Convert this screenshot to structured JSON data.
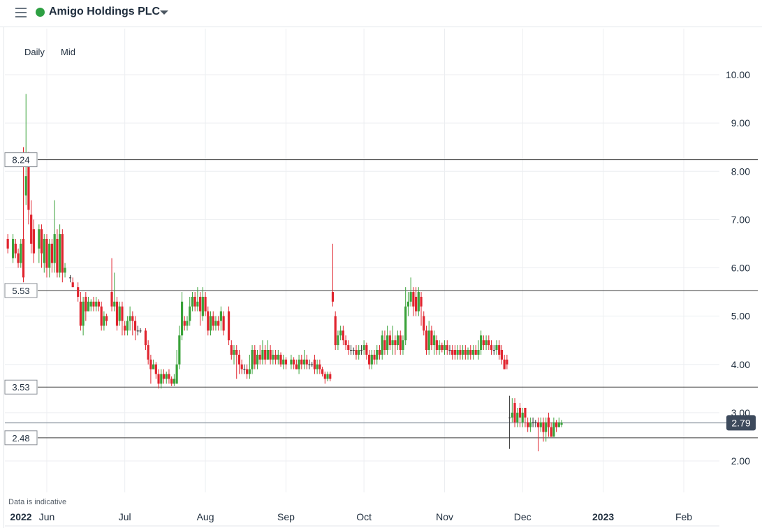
{
  "header": {
    "title": "Amigo Holdings PLC",
    "status_color": "#2ea043"
  },
  "options": {
    "interval": "Daily",
    "price_type": "Mid"
  },
  "note": "Data is indicative",
  "colors": {
    "up": "#3aa23a",
    "down": "#e0242e",
    "flat": "#333333",
    "last_price_tag": "#3d4a5c"
  },
  "chart_data": {
    "type": "candlestick",
    "y_ticks": [
      "2.00",
      "3.00",
      "4.00",
      "5.00",
      "6.00",
      "7.00",
      "8.00",
      "9.00",
      "10.00"
    ],
    "ylim": [
      1.5,
      10.7
    ],
    "x_ticks": [
      {
        "label": "2022",
        "day": -5
      },
      {
        "label": "Jun",
        "day": 0
      },
      {
        "label": "Jul",
        "day": 30
      },
      {
        "label": "Aug",
        "day": 61
      },
      {
        "label": "Sep",
        "day": 92
      },
      {
        "label": "Oct",
        "day": 122
      },
      {
        "label": "Nov",
        "day": 153
      },
      {
        "label": "Dec",
        "day": 183
      },
      {
        "label": "2023",
        "day": 214
      },
      {
        "label": "Feb",
        "day": 245
      }
    ],
    "xlim": [
      -15,
      256
    ],
    "levels": [
      "8.24",
      "5.53",
      "3.53",
      "2.48"
    ],
    "last_price": "2.79",
    "candles": [
      [
        -15,
        6.6,
        6.4,
        6.7,
        6.3
      ],
      [
        -13,
        6.2,
        6.6,
        6.7,
        6.1
      ],
      [
        -12,
        6.5,
        6.3,
        6.6,
        6.2
      ],
      [
        -11,
        6.3,
        6.1,
        6.4,
        6.0
      ],
      [
        -10,
        6.1,
        6.5,
        6.6,
        6.0
      ],
      [
        -9,
        6.6,
        5.8,
        8.5,
        5.7
      ],
      [
        -8,
        7.5,
        7.9,
        9.6,
        7.3
      ],
      [
        -7,
        8.3,
        7.2,
        8.4,
        6.9
      ],
      [
        -6,
        7.1,
        6.5,
        7.4,
        6.3
      ],
      [
        -5,
        6.8,
        6.3,
        7.0,
        6.1
      ],
      [
        -3,
        6.4,
        6.8,
        6.9,
        6.1
      ],
      [
        -2,
        6.8,
        6.3,
        6.9,
        6.0
      ],
      [
        -1,
        6.1,
        6.6,
        6.7,
        5.9
      ],
      [
        0,
        6.6,
        6.0,
        6.7,
        5.8
      ],
      [
        1,
        6.0,
        6.5,
        6.6,
        5.8
      ],
      [
        2,
        6.5,
        6.1,
        6.6,
        5.9
      ],
      [
        3,
        6.1,
        6.7,
        7.4,
        5.9
      ],
      [
        4,
        6.6,
        5.9,
        6.8,
        5.8
      ],
      [
        5,
        5.9,
        6.7,
        6.9,
        5.8
      ],
      [
        6,
        6.7,
        5.9,
        6.8,
        5.7
      ],
      [
        7,
        5.9,
        6.0,
        6.1,
        5.8
      ],
      [
        9,
        5.8,
        5.8,
        5.85,
        5.7
      ],
      [
        10,
        5.7,
        5.6,
        5.8,
        5.6
      ],
      [
        12,
        5.6,
        5.4,
        5.7,
        5.3
      ],
      [
        13,
        5.3,
        4.8,
        5.5,
        4.7
      ],
      [
        14,
        4.8,
        5.3,
        5.4,
        4.6
      ],
      [
        15,
        5.4,
        5.1,
        5.5,
        4.9
      ],
      [
        16,
        5.1,
        5.3,
        5.4,
        5.1
      ],
      [
        17,
        5.2,
        5.3,
        5.35,
        5.1
      ],
      [
        18,
        5.3,
        5.2,
        5.4,
        5.1
      ],
      [
        19,
        5.2,
        5.3,
        5.4,
        5.1
      ],
      [
        20,
        5.3,
        5.2,
        5.35,
        5.1
      ],
      [
        21,
        5.2,
        4.8,
        5.3,
        4.7
      ],
      [
        22,
        4.8,
        5.0,
        5.1,
        4.7
      ],
      [
        23,
        5.0,
        4.9,
        5.05,
        4.8
      ],
      [
        25,
        5.5,
        5.2,
        6.2,
        5.1
      ],
      [
        26,
        5.2,
        5.3,
        5.9,
        5.1
      ],
      [
        27,
        5.3,
        4.8,
        5.4,
        4.7
      ],
      [
        28,
        4.9,
        5.2,
        5.3,
        4.8
      ],
      [
        29,
        5.2,
        4.9,
        5.3,
        4.6
      ],
      [
        30,
        4.8,
        4.7,
        4.9,
        4.6
      ],
      [
        31,
        4.7,
        4.9,
        5.0,
        4.6
      ],
      [
        32,
        4.9,
        5.0,
        5.2,
        4.7
      ],
      [
        33,
        5.0,
        4.9,
        5.1,
        4.6
      ],
      [
        34,
        4.9,
        4.7,
        5.0,
        4.5
      ],
      [
        35,
        4.7,
        4.7,
        4.8,
        4.6
      ],
      [
        36,
        4.7,
        4.7,
        4.75,
        4.65
      ],
      [
        38,
        4.7,
        4.4,
        4.75,
        4.3
      ],
      [
        39,
        4.4,
        4.1,
        4.5,
        4.0
      ],
      [
        40,
        4.1,
        3.9,
        4.2,
        3.6
      ],
      [
        41,
        3.9,
        4.0,
        4.1,
        3.9
      ],
      [
        42,
        4.0,
        3.8,
        4.05,
        3.7
      ],
      [
        43,
        3.8,
        3.6,
        3.9,
        3.5
      ],
      [
        44,
        3.6,
        3.8,
        3.9,
        3.5
      ],
      [
        45,
        3.8,
        3.7,
        3.9,
        3.6
      ],
      [
        46,
        3.7,
        3.8,
        3.85,
        3.6
      ],
      [
        47,
        3.8,
        3.7,
        3.9,
        3.6
      ],
      [
        48,
        3.7,
        3.6,
        3.75,
        3.55
      ],
      [
        49,
        3.6,
        3.7,
        3.8,
        3.55
      ],
      [
        50,
        3.6,
        4.0,
        4.3,
        3.6
      ],
      [
        51,
        4.0,
        4.6,
        4.8,
        3.9
      ],
      [
        52,
        4.6,
        5.3,
        5.5,
        4.5
      ],
      [
        53,
        4.9,
        4.8,
        5.0,
        4.7
      ],
      [
        54,
        4.8,
        4.9,
        5.0,
        4.7
      ],
      [
        55,
        4.9,
        5.2,
        5.4,
        4.8
      ],
      [
        56,
        5.2,
        5.4,
        5.5,
        5.1
      ],
      [
        57,
        5.4,
        5.2,
        5.5,
        5.1
      ],
      [
        58,
        5.2,
        5.3,
        5.6,
        5.1
      ],
      [
        59,
        5.4,
        5.1,
        5.5,
        4.8
      ],
      [
        60,
        5.0,
        5.4,
        5.6,
        4.9
      ],
      [
        61,
        5.4,
        5.1,
        5.5,
        5.0
      ],
      [
        62,
        5.1,
        4.7,
        5.2,
        4.6
      ],
      [
        63,
        4.7,
        5.0,
        5.1,
        4.6
      ],
      [
        64,
        5.0,
        4.8,
        5.1,
        4.7
      ],
      [
        65,
        4.8,
        4.9,
        5.0,
        4.7
      ],
      [
        66,
        4.9,
        4.8,
        5.0,
        4.7
      ],
      [
        67,
        4.9,
        5.1,
        5.2,
        4.7
      ],
      [
        68,
        5.0,
        4.7,
        5.1,
        4.6
      ],
      [
        70,
        5.1,
        4.5,
        5.2,
        4.4
      ],
      [
        71,
        4.4,
        4.2,
        4.5,
        4.1
      ],
      [
        72,
        4.2,
        4.3,
        4.4,
        4.0
      ],
      [
        73,
        4.3,
        4.2,
        4.4,
        3.7
      ],
      [
        74,
        4.2,
        4.0,
        4.3,
        3.8
      ],
      [
        75,
        4.0,
        3.9,
        4.1,
        3.8
      ],
      [
        76,
        3.9,
        3.9,
        4.0,
        3.8
      ],
      [
        77,
        3.9,
        3.8,
        4.0,
        3.7
      ],
      [
        78,
        3.8,
        3.9,
        4.2,
        3.7
      ],
      [
        79,
        3.9,
        4.3,
        4.4,
        3.8
      ],
      [
        80,
        4.3,
        4.0,
        4.4,
        3.9
      ],
      [
        81,
        4.0,
        4.2,
        4.3,
        3.9
      ],
      [
        82,
        4.2,
        4.1,
        4.4,
        4.0
      ],
      [
        83,
        4.1,
        4.3,
        4.5,
        4.0
      ],
      [
        84,
        4.3,
        4.1,
        4.4,
        4.0
      ],
      [
        85,
        4.1,
        4.3,
        4.5,
        4.1
      ],
      [
        86,
        4.3,
        4.1,
        4.4,
        4.0
      ],
      [
        87,
        4.1,
        4.2,
        4.3,
        4.0
      ],
      [
        88,
        4.2,
        4.1,
        4.3,
        4.0
      ],
      [
        89,
        4.1,
        4.2,
        4.3,
        4.0
      ],
      [
        90,
        4.2,
        4.0,
        4.25,
        3.95
      ],
      [
        91,
        4.0,
        4.1,
        4.2,
        3.9
      ],
      [
        92,
        4.1,
        4.0,
        4.15,
        3.9
      ],
      [
        94,
        4.0,
        4.1,
        4.2,
        3.9
      ],
      [
        95,
        4.1,
        4.0,
        4.15,
        3.9
      ],
      [
        96,
        4.0,
        3.9,
        4.1,
        3.9
      ],
      [
        97,
        3.9,
        4.1,
        4.2,
        3.8
      ],
      [
        98,
        4.1,
        4.0,
        4.2,
        3.9
      ],
      [
        99,
        4.0,
        4.1,
        4.3,
        3.9
      ],
      [
        100,
        4.1,
        4.0,
        4.2,
        3.9
      ],
      [
        101,
        4.0,
        4.0,
        4.1,
        3.9
      ],
      [
        102,
        4.0,
        4.0,
        4.05,
        3.95
      ],
      [
        103,
        4.1,
        3.9,
        4.2,
        3.8
      ],
      [
        104,
        3.9,
        4.0,
        4.1,
        3.8
      ],
      [
        105,
        4.0,
        3.9,
        4.1,
        3.8
      ],
      [
        106,
        3.9,
        3.8,
        3.95,
        3.75
      ],
      [
        107,
        3.8,
        3.7,
        3.85,
        3.6
      ],
      [
        108,
        3.7,
        3.8,
        3.85,
        3.65
      ],
      [
        109,
        3.8,
        3.7,
        3.85,
        3.65
      ],
      [
        110,
        5.5,
        5.3,
        6.5,
        5.2
      ],
      [
        111,
        5.0,
        4.4,
        5.1,
        4.3
      ],
      [
        112,
        4.4,
        4.6,
        4.7,
        4.3
      ],
      [
        113,
        4.6,
        4.7,
        4.8,
        4.5
      ],
      [
        114,
        4.7,
        4.5,
        4.8,
        4.4
      ],
      [
        115,
        4.5,
        4.4,
        4.6,
        4.3
      ],
      [
        116,
        4.4,
        4.3,
        4.5,
        4.2
      ],
      [
        117,
        4.3,
        4.3,
        4.4,
        4.2
      ],
      [
        118,
        4.3,
        4.3,
        4.35,
        4.2
      ],
      [
        119,
        4.3,
        4.2,
        4.4,
        4.1
      ],
      [
        120,
        4.2,
        4.3,
        4.4,
        4.1
      ],
      [
        121,
        4.3,
        4.3,
        4.4,
        4.2
      ],
      [
        122,
        4.3,
        4.4,
        4.5,
        4.2
      ],
      [
        123,
        4.4,
        4.2,
        4.45,
        4.1
      ],
      [
        124,
        4.2,
        4.0,
        4.3,
        3.9
      ],
      [
        125,
        4.0,
        4.2,
        4.3,
        3.9
      ],
      [
        126,
        4.2,
        4.1,
        4.3,
        4.0
      ],
      [
        127,
        4.1,
        4.3,
        4.4,
        4.0
      ],
      [
        128,
        4.3,
        4.2,
        4.4,
        4.1
      ],
      [
        129,
        4.2,
        4.6,
        4.7,
        4.1
      ],
      [
        130,
        4.5,
        4.3,
        4.7,
        4.2
      ],
      [
        131,
        4.3,
        4.6,
        4.8,
        4.2
      ],
      [
        132,
        4.6,
        4.4,
        4.7,
        4.3
      ],
      [
        133,
        4.4,
        4.5,
        4.8,
        4.2
      ],
      [
        134,
        4.5,
        4.4,
        4.6,
        4.2
      ],
      [
        135,
        4.4,
        4.6,
        4.7,
        4.3
      ],
      [
        136,
        4.6,
        4.3,
        4.7,
        4.2
      ],
      [
        137,
        4.3,
        4.5,
        4.6,
        4.2
      ],
      [
        138,
        4.5,
        5.2,
        5.6,
        4.4
      ],
      [
        139,
        5.2,
        5.3,
        5.5,
        5.0
      ],
      [
        140,
        5.3,
        5.5,
        5.8,
        5.2
      ],
      [
        141,
        5.5,
        5.2,
        5.6,
        5.0
      ],
      [
        142,
        5.4,
        5.1,
        5.6,
        5.0
      ],
      [
        143,
        5.1,
        5.5,
        5.6,
        5.0
      ],
      [
        144,
        5.4,
        5.2,
        5.5,
        4.8
      ],
      [
        145,
        5.0,
        4.7,
        5.1,
        4.6
      ],
      [
        146,
        4.7,
        4.3,
        4.8,
        4.2
      ],
      [
        147,
        4.3,
        4.7,
        4.9,
        4.2
      ],
      [
        148,
        4.7,
        4.4,
        4.8,
        4.3
      ],
      [
        149,
        4.4,
        4.6,
        4.7,
        4.2
      ],
      [
        150,
        4.5,
        4.3,
        4.6,
        4.2
      ],
      [
        151,
        4.3,
        4.4,
        4.5,
        4.2
      ],
      [
        152,
        4.4,
        4.3,
        4.45,
        4.25
      ],
      [
        153,
        4.3,
        4.4,
        4.5,
        4.2
      ],
      [
        154,
        4.4,
        4.3,
        4.5,
        4.2
      ],
      [
        155,
        4.3,
        4.3,
        4.4,
        4.2
      ],
      [
        156,
        4.3,
        4.2,
        4.4,
        4.1
      ],
      [
        157,
        4.3,
        4.2,
        4.4,
        4.1
      ],
      [
        158,
        4.2,
        4.3,
        4.4,
        4.1
      ],
      [
        159,
        4.3,
        4.2,
        4.4,
        4.1
      ],
      [
        160,
        4.2,
        4.3,
        4.4,
        4.1
      ],
      [
        161,
        4.3,
        4.2,
        4.4,
        4.1
      ],
      [
        162,
        4.2,
        4.3,
        4.35,
        4.1
      ],
      [
        163,
        4.3,
        4.2,
        4.4,
        4.1
      ],
      [
        164,
        4.2,
        4.3,
        4.4,
        4.1
      ],
      [
        165,
        4.3,
        4.2,
        4.4,
        4.2
      ],
      [
        166,
        4.2,
        4.3,
        4.5,
        4.1
      ],
      [
        167,
        4.3,
        4.6,
        4.7,
        4.2
      ],
      [
        168,
        4.5,
        4.4,
        4.6,
        4.3
      ],
      [
        169,
        4.4,
        4.5,
        4.6,
        4.3
      ],
      [
        170,
        4.5,
        4.4,
        4.6,
        4.3
      ],
      [
        171,
        4.4,
        4.3,
        4.5,
        4.2
      ],
      [
        172,
        4.3,
        4.3,
        4.4,
        4.2
      ],
      [
        173,
        4.3,
        4.4,
        4.5,
        4.2
      ],
      [
        174,
        4.4,
        4.2,
        4.5,
        4.1
      ],
      [
        175,
        4.3,
        4.1,
        4.4,
        4.0
      ],
      [
        176,
        4.1,
        3.9,
        4.2,
        3.9
      ],
      [
        177,
        4.1,
        4.0,
        4.2,
        3.9
      ],
      [
        178,
        2.9,
        2.9,
        3.35,
        2.25
      ],
      [
        179,
        2.9,
        3.0,
        3.3,
        2.8
      ],
      [
        180,
        3.2,
        2.8,
        3.3,
        2.7
      ],
      [
        181,
        2.8,
        3.0,
        3.1,
        2.7
      ],
      [
        182,
        3.1,
        2.9,
        3.2,
        2.7
      ],
      [
        183,
        2.8,
        3.0,
        3.1,
        2.7
      ],
      [
        184,
        3.1,
        2.9,
        3.1,
        2.7
      ],
      [
        185,
        2.8,
        2.7,
        2.9,
        2.6
      ],
      [
        186,
        2.7,
        2.8,
        2.9,
        2.6
      ],
      [
        187,
        2.8,
        2.8,
        2.9,
        2.7
      ],
      [
        188,
        2.8,
        2.8,
        2.85,
        2.7
      ],
      [
        189,
        2.8,
        2.7,
        2.9,
        2.2
      ],
      [
        190,
        2.7,
        2.8,
        2.9,
        2.6
      ],
      [
        191,
        2.8,
        2.6,
        2.9,
        2.4
      ],
      [
        192,
        2.6,
        2.8,
        2.9,
        2.4
      ],
      [
        193,
        2.9,
        2.7,
        3.0,
        2.5
      ],
      [
        194,
        2.7,
        2.5,
        2.8,
        2.5
      ],
      [
        195,
        2.5,
        2.8,
        2.9,
        2.5
      ],
      [
        196,
        2.8,
        2.7,
        2.85,
        2.6
      ],
      [
        197,
        2.7,
        2.8,
        2.9,
        2.7
      ],
      [
        198,
        2.75,
        2.79,
        2.85,
        2.7
      ]
    ]
  }
}
